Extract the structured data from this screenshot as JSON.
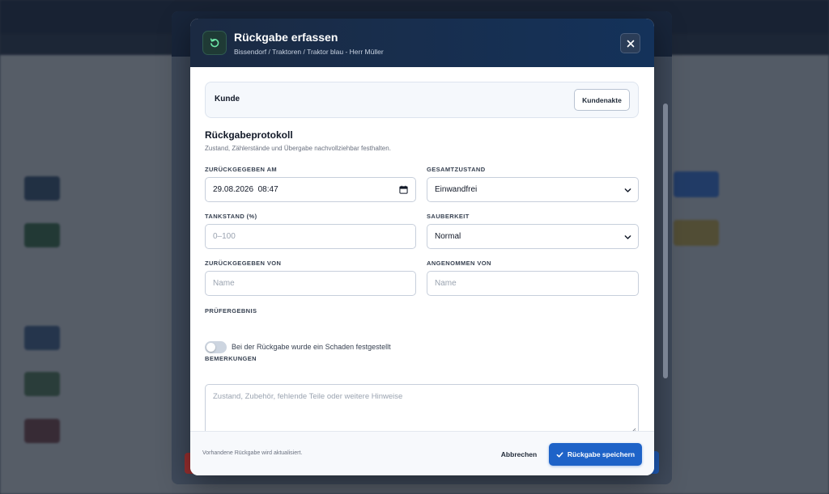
{
  "modal": {
    "title": "Rückgabe erfassen",
    "subtitle": "Bissendorf / Traktoren / Traktor blau - Herr Müller",
    "header_icon": "return-arrow-icon",
    "close_icon": "close-icon"
  },
  "customer": {
    "label": "Kunde",
    "file_button": "Kundenakte"
  },
  "protocol": {
    "title": "Rückgabeprotokoll",
    "description": "Zustand, Zählerstände und Übergabe nachvollziehbar festhalten."
  },
  "form": {
    "returned_at": {
      "label": "ZURÜCKGEGEBEN AM",
      "value": "29.08.2026  08:47"
    },
    "overall_condition": {
      "label": "GESAMTZUSTAND",
      "value": "Einwandfrei"
    },
    "tank_level": {
      "label": "TANKSTAND (%)",
      "placeholder": "0–100"
    },
    "cleanliness": {
      "label": "SAUBERKEIT",
      "value": "Normal"
    },
    "returned_by": {
      "label": "ZURÜCKGEGEBEN VON",
      "placeholder": "Name"
    },
    "accepted_by": {
      "label": "ANGENOMMEN VON",
      "placeholder": "Name"
    },
    "inspection": {
      "label": "PRÜFERGEBNIS",
      "toggle_label": "Bei der Rückgabe wurde ein Schaden festgestellt",
      "damage": false
    },
    "remarks": {
      "label": "BEMERKUNGEN",
      "placeholder": "Zustand, Zubehör, fehlende Teile oder weitere Hinweise"
    }
  },
  "footer": {
    "note": "Vorhandene Rückgabe wird aktualisiert.",
    "cancel": "Abbrechen",
    "save": "Rückgabe speichern"
  },
  "colors": {
    "header": "#1b2a42",
    "primary": "#1e63c8",
    "accent_green": "#6ee7a8"
  }
}
